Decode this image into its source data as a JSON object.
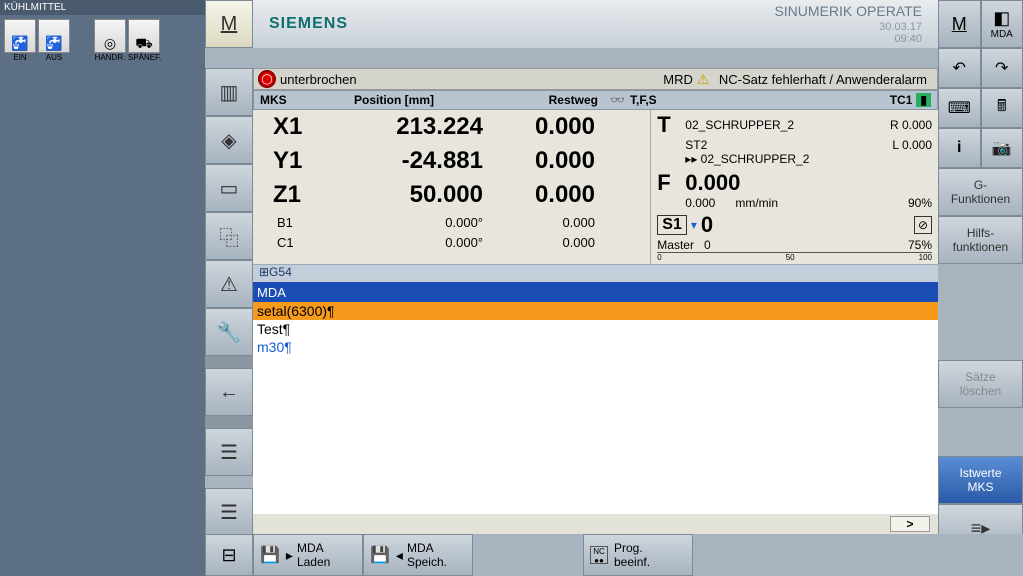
{
  "coolant": {
    "title": "KÜHLMITTEL",
    "ein": "EIN",
    "aus": "AUS",
    "handr": "HANDR.",
    "spaenef": "SPÄNEF."
  },
  "header": {
    "brand": "SIEMENS",
    "operate": "SINUMERIK OPERATE",
    "date": "30.03.17",
    "time": "09:40"
  },
  "tr": {
    "m": "M",
    "mda": "MDA"
  },
  "status": {
    "state": "unterbrochen",
    "mrd": "MRD",
    "alarm": "NC-Satz fehlerhaft / Anwenderalarm"
  },
  "cols": {
    "mks": "MKS",
    "position": "Position [mm]",
    "restweg": "Restweg",
    "tfs": "T,F,S",
    "tc": "TC1"
  },
  "axes": [
    {
      "name": "X1",
      "pos": "213.224",
      "rest": "0.000"
    },
    {
      "name": "Y1",
      "pos": "-24.881",
      "rest": "0.000"
    },
    {
      "name": "Z1",
      "pos": "50.000",
      "rest": "0.000"
    }
  ],
  "axes_small": [
    {
      "name": "B1",
      "pos": "0.000°",
      "rest": "0.000"
    },
    {
      "name": "C1",
      "pos": "0.000°",
      "rest": "0.000"
    }
  ],
  "tool": {
    "T": "T",
    "name": "02_SCHRUPPER_2",
    "st": "ST2",
    "r": "R 0.000",
    "l": "L 0.000",
    "next": "▸▸ 02_SCHRUPPER_2"
  },
  "feed": {
    "F": "F",
    "value": "0.000",
    "actual": "0.000",
    "unit": "mm/min",
    "pct": "90%"
  },
  "spindle": {
    "S": "S1",
    "tri": "▾",
    "value": "0",
    "master": "Master",
    "mval": "0",
    "scale0": "0",
    "scale50": "50",
    "scale100": "100",
    "pct": "75%"
  },
  "g54": "⊞G54",
  "mda": {
    "title": "MDA",
    "lines": [
      "setal(6300)¶",
      "Test¶",
      "m30¶"
    ]
  },
  "foot_btn": ">",
  "softkeys": {
    "gfunc": "G-\nFunktionen",
    "hilfs": "Hilfs-\nfunktionen",
    "saetze": "Sätze\nlöschen",
    "istwerte": "Istwerte\nMKS"
  },
  "bottom": {
    "mda_laden": "MDA\nLaden",
    "mda_speich": "MDA\nSpeich.",
    "prog_beeinf": "Prog.\nbeeinf."
  },
  "icons": {
    "i": "i",
    "cam": "📷",
    "undo": "↶",
    "redo": "↷",
    "kbd": "⌨",
    "calc": "🖩"
  }
}
